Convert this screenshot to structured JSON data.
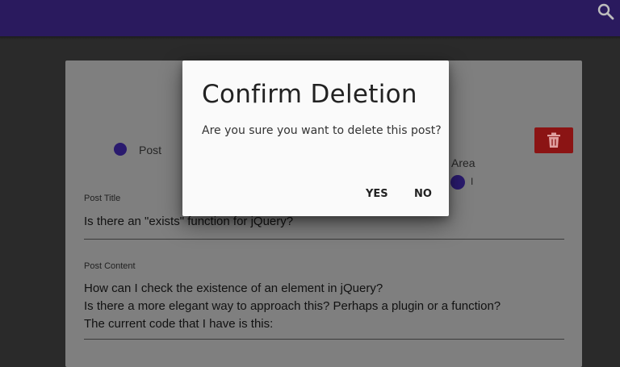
{
  "app_bar": {
    "search_icon": "search-icon",
    "color": "#2a1a5e"
  },
  "post_form": {
    "type_options": {
      "post_label": "Post",
      "area_label": "Area",
      "area_subtext": "I"
    },
    "delete_icon": "trash-icon",
    "title_field": {
      "label": "Post Title",
      "value": "Is there an \"exists\" function for jQuery?"
    },
    "content_field": {
      "label": "Post Content",
      "lines": [
        "How can I check the existence of an element in jQuery?",
        "Is there a more elegant way to approach this? Perhaps a plugin or a function?",
        "The current code that I have is this:"
      ]
    }
  },
  "dialog": {
    "title": "Confirm Deletion",
    "message": "Are you sure you want to delete this post?",
    "yes_label": "YES",
    "no_label": "NO"
  },
  "colors": {
    "accent": "#2a1a6e",
    "danger": "#8b1414"
  }
}
